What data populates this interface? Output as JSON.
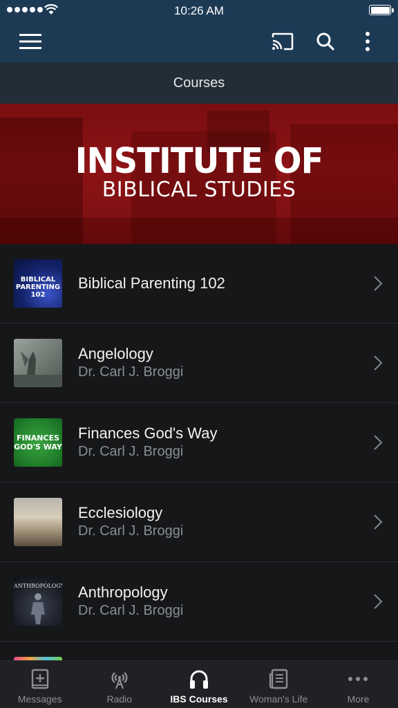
{
  "status_bar": {
    "time": "10:26 AM"
  },
  "nav": {
    "menu_icon": "hamburger-icon",
    "actions": [
      "cast-icon",
      "search-icon",
      "more-vertical-icon"
    ]
  },
  "title": "Courses",
  "banner": {
    "line1": "INSTITUTE OF",
    "line2": "BIBLICAL STUDIES"
  },
  "courses": [
    {
      "title": "Biblical Parenting 102",
      "subtitle": "",
      "thumb_text": "BIBLICAL PARENTING 102"
    },
    {
      "title": "Angelology",
      "subtitle": "Dr. Carl J. Broggi",
      "thumb_text": ""
    },
    {
      "title": "Finances God's Way",
      "subtitle": "Dr. Carl J. Broggi",
      "thumb_text": "FINANCES GOD'S WAY"
    },
    {
      "title": "Ecclesiology",
      "subtitle": "Dr. Carl J. Broggi",
      "thumb_text": ""
    },
    {
      "title": "Anthropology",
      "subtitle": "Dr. Carl J. Broggi",
      "thumb_text": "ANTHROPOLOGY"
    }
  ],
  "tabs": [
    {
      "label": "Messages",
      "icon": "book-plus-icon"
    },
    {
      "label": "Radio",
      "icon": "radio-tower-icon"
    },
    {
      "label": "IBS Courses",
      "icon": "headphones-icon",
      "active": true
    },
    {
      "label": "Woman's Life",
      "icon": "newspaper-icon"
    },
    {
      "label": "More",
      "icon": "more-horizontal-icon"
    }
  ],
  "colors": {
    "nav": "#1d3a55",
    "title_bar": "#232d37",
    "banner": "#8d1316",
    "list_bg": "#161719",
    "tab_bar": "#202124"
  }
}
